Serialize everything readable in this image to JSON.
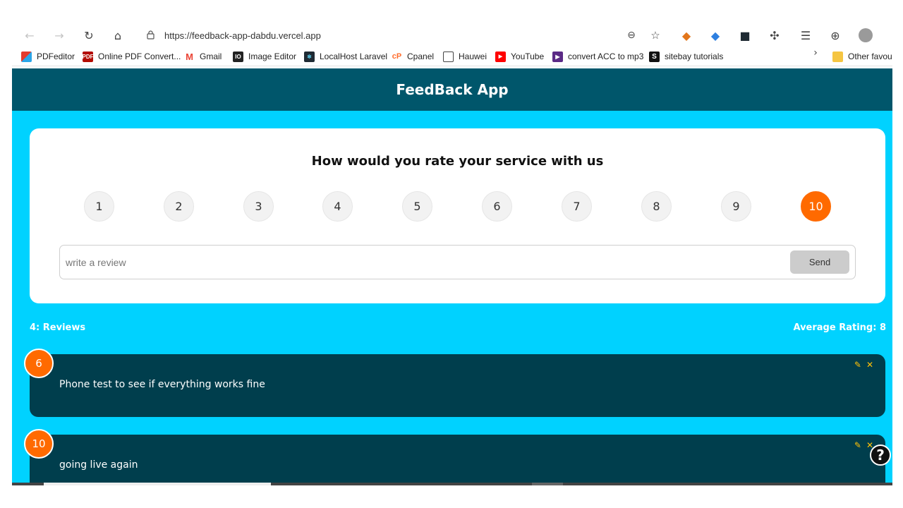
{
  "browser": {
    "url": "https://feedback-app-dabdu.vercel.app",
    "nav_icons": [
      "back-arrow-icon",
      "forward-arrow-icon",
      "refresh-icon",
      "home-icon"
    ],
    "right_icons": [
      "zoom-icon",
      "favorite-icon",
      "metamask-icon",
      "extension-icon",
      "react-devtools-icon",
      "extensions-puzzle-icon",
      "favorites-icon",
      "collections-icon",
      "profile-icon"
    ]
  },
  "bookmarks": [
    {
      "label": "PDFeditor",
      "icon": "pdfeditor-icon",
      "color": "#e23b2e"
    },
    {
      "label": "Online PDF Convert...",
      "icon": "pdf-icon",
      "color": "#b30b00"
    },
    {
      "label": "Gmail",
      "icon": "gmail-icon",
      "color": "#ea4335"
    },
    {
      "label": "Image Editor",
      "icon": "image-editor-icon",
      "color": "#222222"
    },
    {
      "label": "LocalHost Laravel",
      "icon": "react-icon",
      "color": "#1f2a33"
    },
    {
      "label": "Cpanel",
      "icon": "cpanel-icon",
      "color": "#ff6c2c"
    },
    {
      "label": "Hauwei",
      "icon": "page-icon",
      "color": "#ffffff"
    },
    {
      "label": "YouTube",
      "icon": "youtube-icon",
      "color": "#ff0000"
    },
    {
      "label": "convert ACC to mp3",
      "icon": "converter-icon",
      "color": "#5b2a86"
    },
    {
      "label": "sitebay tutorials",
      "icon": "sitebay-icon",
      "color": "#111111"
    },
    {
      "label": "Other favour",
      "icon": "folder-icon",
      "color": "#f5c542"
    }
  ],
  "app": {
    "title": "FeedBack App",
    "question": "How would you rate your service with us",
    "ratings": [
      "1",
      "2",
      "3",
      "4",
      "5",
      "6",
      "7",
      "8",
      "9",
      "10"
    ],
    "selected_rating": "10",
    "review_placeholder": "write a review",
    "send_label": "Send",
    "review_count_label": "4: Reviews",
    "average_label": "Average Rating: 8",
    "reviews": [
      {
        "rating": "6",
        "text": "Phone test to see if everything works fine"
      },
      {
        "rating": "10",
        "text": "going live again"
      }
    ],
    "help_label": "?",
    "colors": {
      "header": "#00566b",
      "background": "#00d2ff",
      "accent": "#ff6a00",
      "review_card": "#003e4d",
      "action_icons": "#ffc107"
    }
  }
}
